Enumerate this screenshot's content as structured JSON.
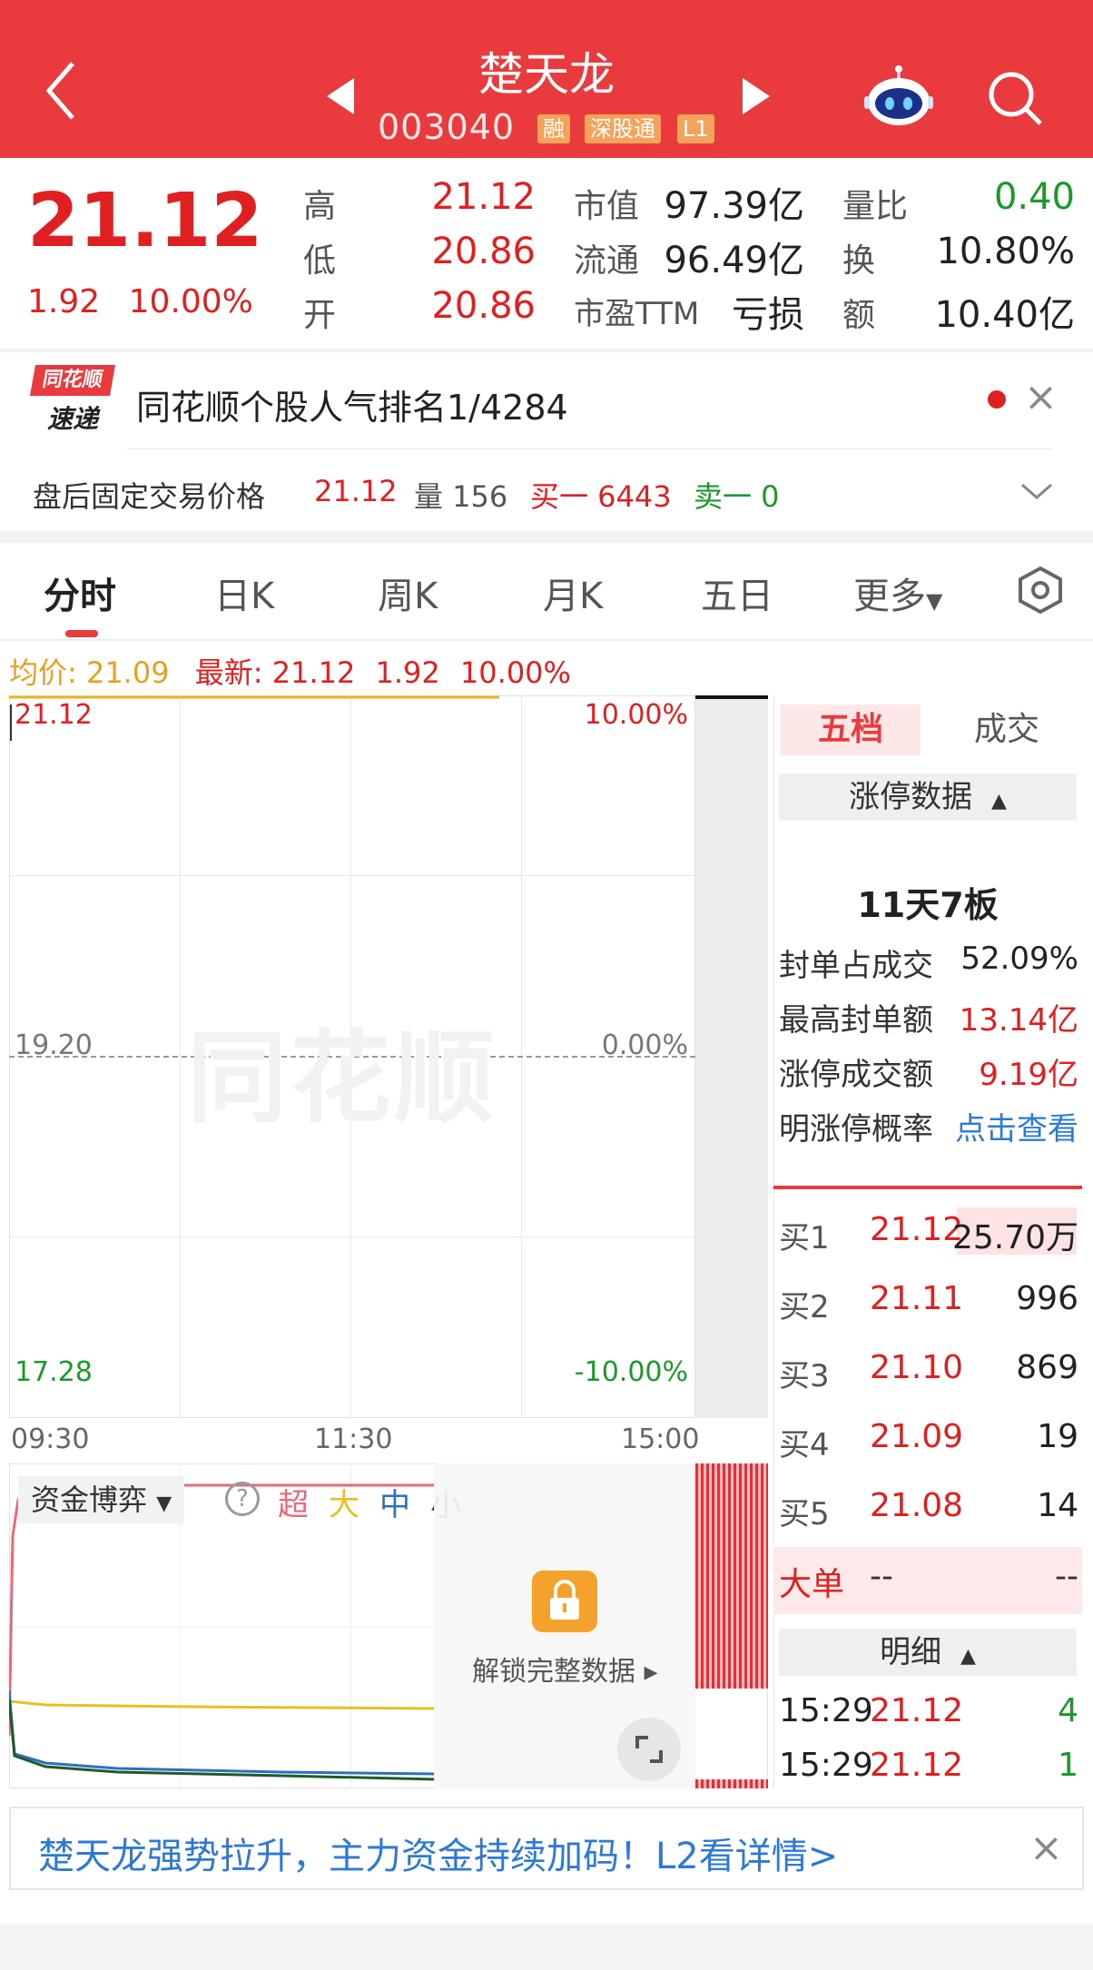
{
  "header": {
    "title": "楚天龙",
    "code": "003040",
    "tags": [
      "融",
      "深股通",
      "L1"
    ]
  },
  "quote": {
    "price": "21.12",
    "change": "1.92",
    "change_pct": "10.00%",
    "high_label": "高",
    "high": "21.12",
    "low_label": "低",
    "low": "20.86",
    "open_label": "开",
    "open": "20.86",
    "mktcap_label": "市值",
    "mktcap": "97.39亿",
    "float_label": "流通",
    "float": "96.49亿",
    "pe_label": "市盈TTM",
    "pe": "亏损",
    "volratio_label": "量比",
    "volratio": "0.40",
    "turnover_label": "换",
    "turnover": "10.80%",
    "amount_label": "额",
    "amount": "10.40亿"
  },
  "express": {
    "logo_top": "同花顺",
    "logo_bottom": "速递",
    "text": "同花顺个股人气排名1/4284"
  },
  "after_hours": {
    "label": "盘后固定交易价格",
    "price": "21.12",
    "vol_label": "量 156",
    "buy1": "买一 6443",
    "sell1": "卖一 0"
  },
  "tabs": [
    "分时",
    "日K",
    "周K",
    "月K",
    "五日",
    "更多"
  ],
  "avg_info": {
    "avg": "均价: 21.09",
    "latest": "最新: 21.12",
    "chg": "1.92",
    "pct": "10.00%"
  },
  "chart_data": {
    "type": "line",
    "y_left_ticks": [
      "21.12",
      "19.20",
      "17.28"
    ],
    "y_right_ticks": [
      "10.00%",
      "0.00%",
      "-10.00%"
    ],
    "x_ticks": [
      "09:30",
      "11:30",
      "15:00"
    ],
    "ylim": [
      17.28,
      21.12
    ],
    "series": [
      {
        "values": [
          21.12,
          21.12,
          21.12,
          21.12,
          21.12
        ],
        "color": "#f0b020"
      }
    ],
    "watermark": "同花顺"
  },
  "right_panel": {
    "tab_active": "五档",
    "tab_other": "成交",
    "limit_head": "涨停数据",
    "limit_title": "11天7板",
    "rows": [
      {
        "label": "封单占成交",
        "value": "52.09%"
      },
      {
        "label": "最高封单额",
        "value": "13.14亿"
      },
      {
        "label": "涨停成交额",
        "value": "9.19亿"
      },
      {
        "label": "明涨停概率",
        "value": "点击查看"
      }
    ],
    "orderbook": [
      {
        "label": "买1",
        "price": "21.12",
        "vol": "25.70万"
      },
      {
        "label": "买2",
        "price": "21.11",
        "vol": "996"
      },
      {
        "label": "买3",
        "price": "21.10",
        "vol": "869"
      },
      {
        "label": "买4",
        "price": "21.09",
        "vol": "19"
      },
      {
        "label": "买5",
        "price": "21.08",
        "vol": "14"
      }
    ],
    "big_order_label": "大单",
    "big_order_a": "--",
    "big_order_b": "--",
    "detail_head": "明细",
    "details": [
      {
        "time": "15:29",
        "price": "21.12",
        "vol": "4"
      },
      {
        "time": "15:29",
        "price": "21.12",
        "vol": "1"
      }
    ]
  },
  "capital": {
    "selector": "资金博弈",
    "legend": [
      "超",
      "大",
      "中",
      "小"
    ],
    "legend_colors": [
      "#e86a7a",
      "#e8c020",
      "#2f6fc0",
      "#1f5a2a"
    ],
    "unlock_text": "解锁完整数据 ▸"
  },
  "banner": {
    "text": "楚天龙强势拉升，主力资金持续加码！L2看详情>"
  },
  "colors": {
    "header_red": "#e93a3e",
    "up_red": "#e02020",
    "down_green": "#1a9a2a",
    "link_blue": "#2d79d6"
  }
}
